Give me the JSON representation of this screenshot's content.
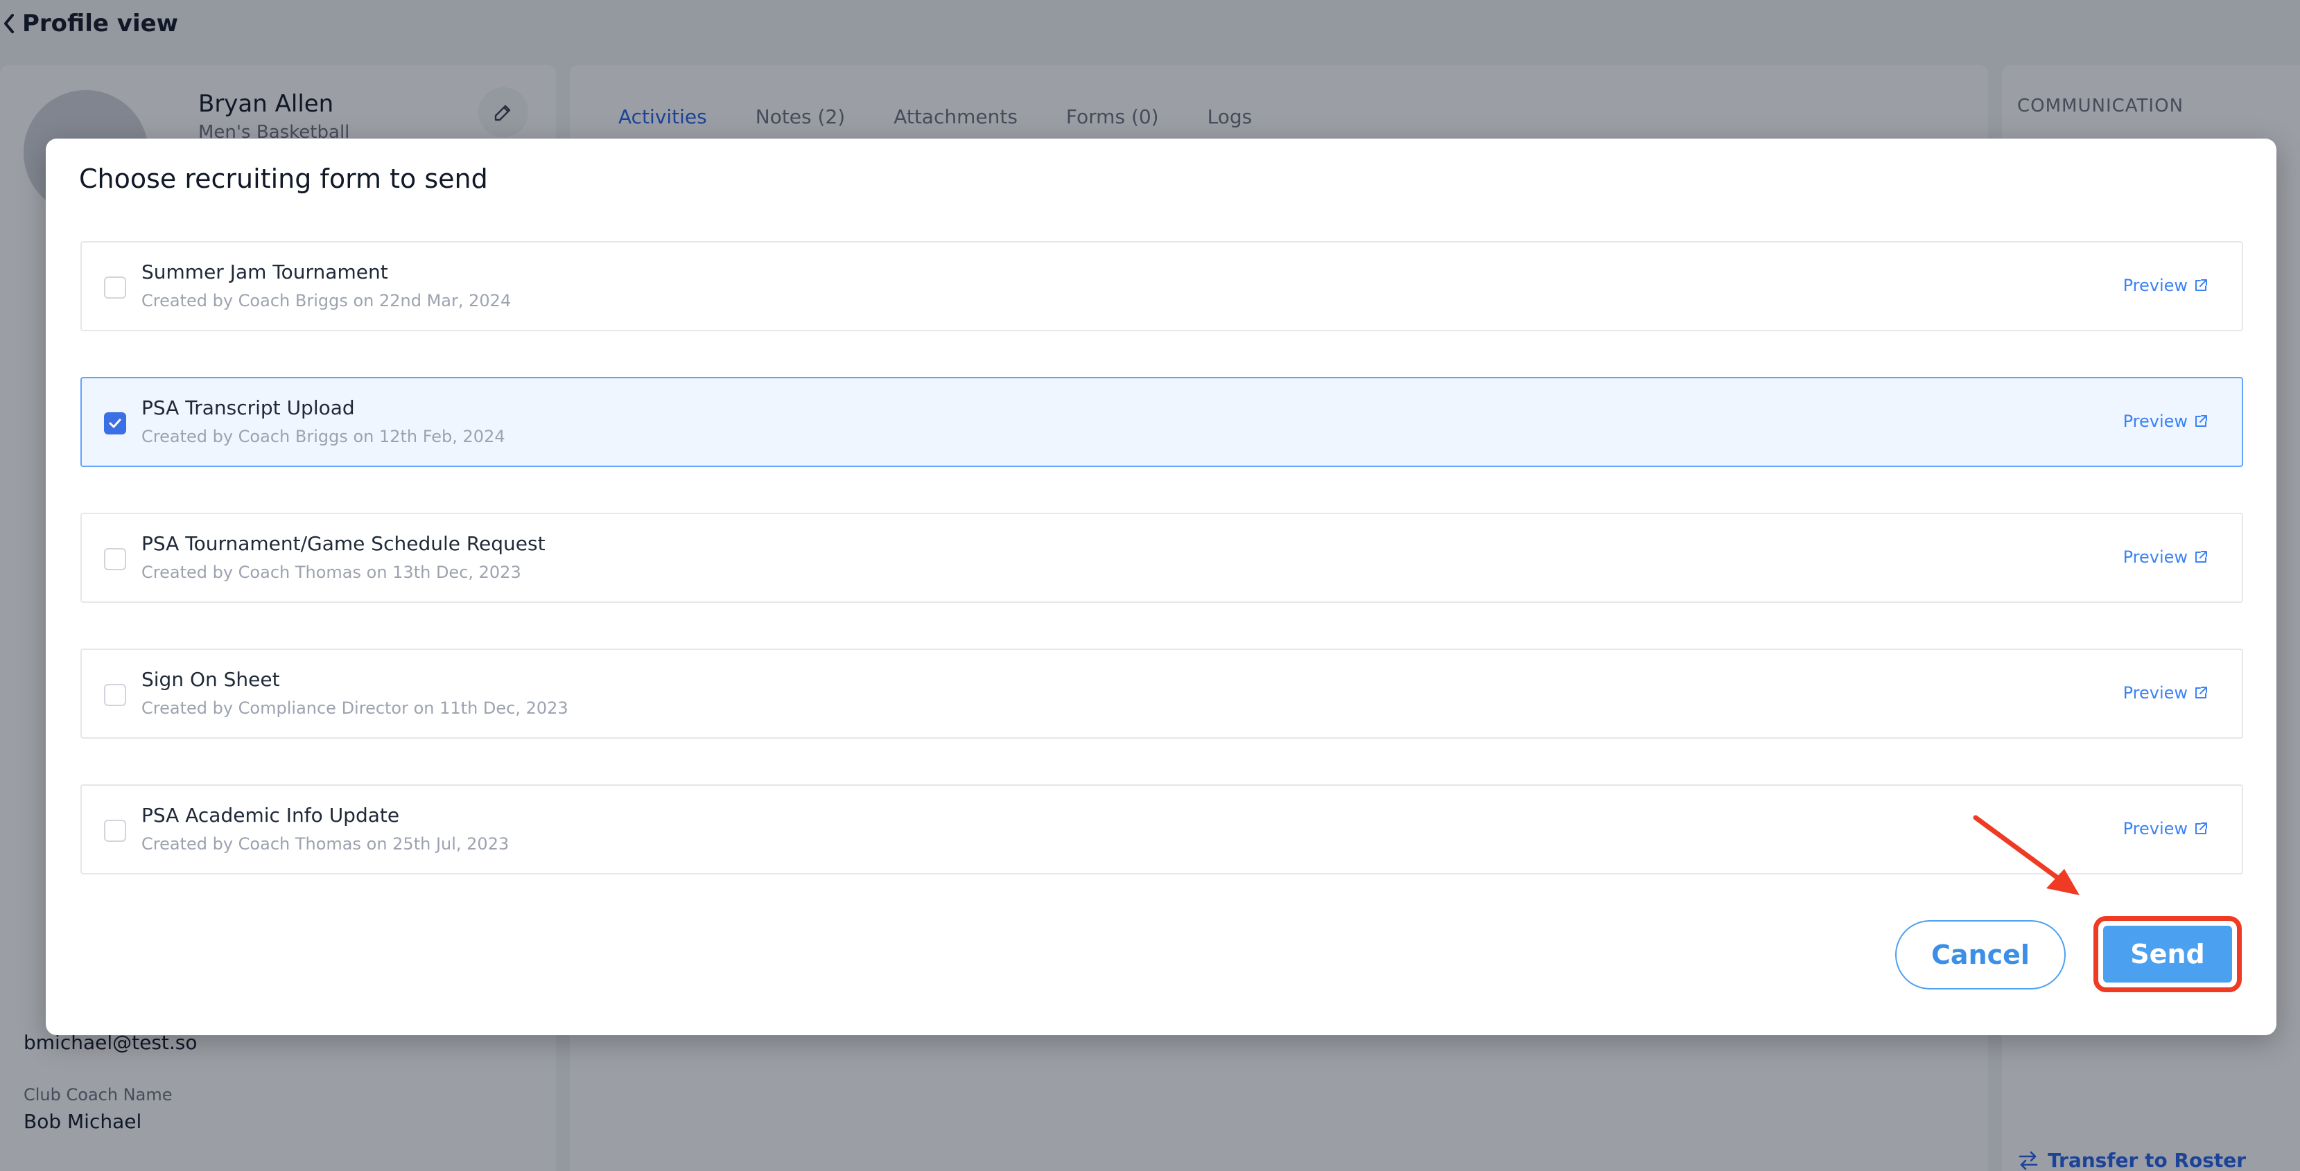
{
  "header": {
    "title": "Profile view"
  },
  "profile": {
    "name": "Bryan Allen",
    "sport": "Men's Basketball",
    "club_coach_email": "bmichael@test.so",
    "club_coach_name_label": "Club Coach Name",
    "club_coach_name": "Bob Michael"
  },
  "tabs": [
    {
      "label": "Activities"
    },
    {
      "label": "Notes (2)"
    },
    {
      "label": "Attachments"
    },
    {
      "label": "Forms (0)"
    },
    {
      "label": "Logs"
    }
  ],
  "right_panel": {
    "heading": "COMMUNICATION",
    "transfer_label": "Transfer to Roster"
  },
  "modal": {
    "title": "Choose recruiting form to send",
    "preview_label": "Preview",
    "forms": [
      {
        "name": "Summer Jam Tournament",
        "meta": "Created by Coach Briggs on 22nd Mar, 2024",
        "checked": false
      },
      {
        "name": "PSA Transcript Upload",
        "meta": "Created by Coach Briggs on 12th Feb, 2024",
        "checked": true
      },
      {
        "name": "PSA Tournament/Game Schedule Request",
        "meta": "Created by Coach Thomas on 13th Dec, 2023",
        "checked": false
      },
      {
        "name": "Sign On Sheet",
        "meta": "Created by Compliance Director on 11th Dec, 2023",
        "checked": false
      },
      {
        "name": "PSA Academic Info Update",
        "meta": "Created by Coach Thomas on 25th Jul, 2023",
        "checked": false
      }
    ],
    "cancel_label": "Cancel",
    "send_label": "Send"
  },
  "colors": {
    "accent": "#4ca0f0",
    "highlight": "#ef3b24",
    "selected_bg": "#eff6ff"
  }
}
